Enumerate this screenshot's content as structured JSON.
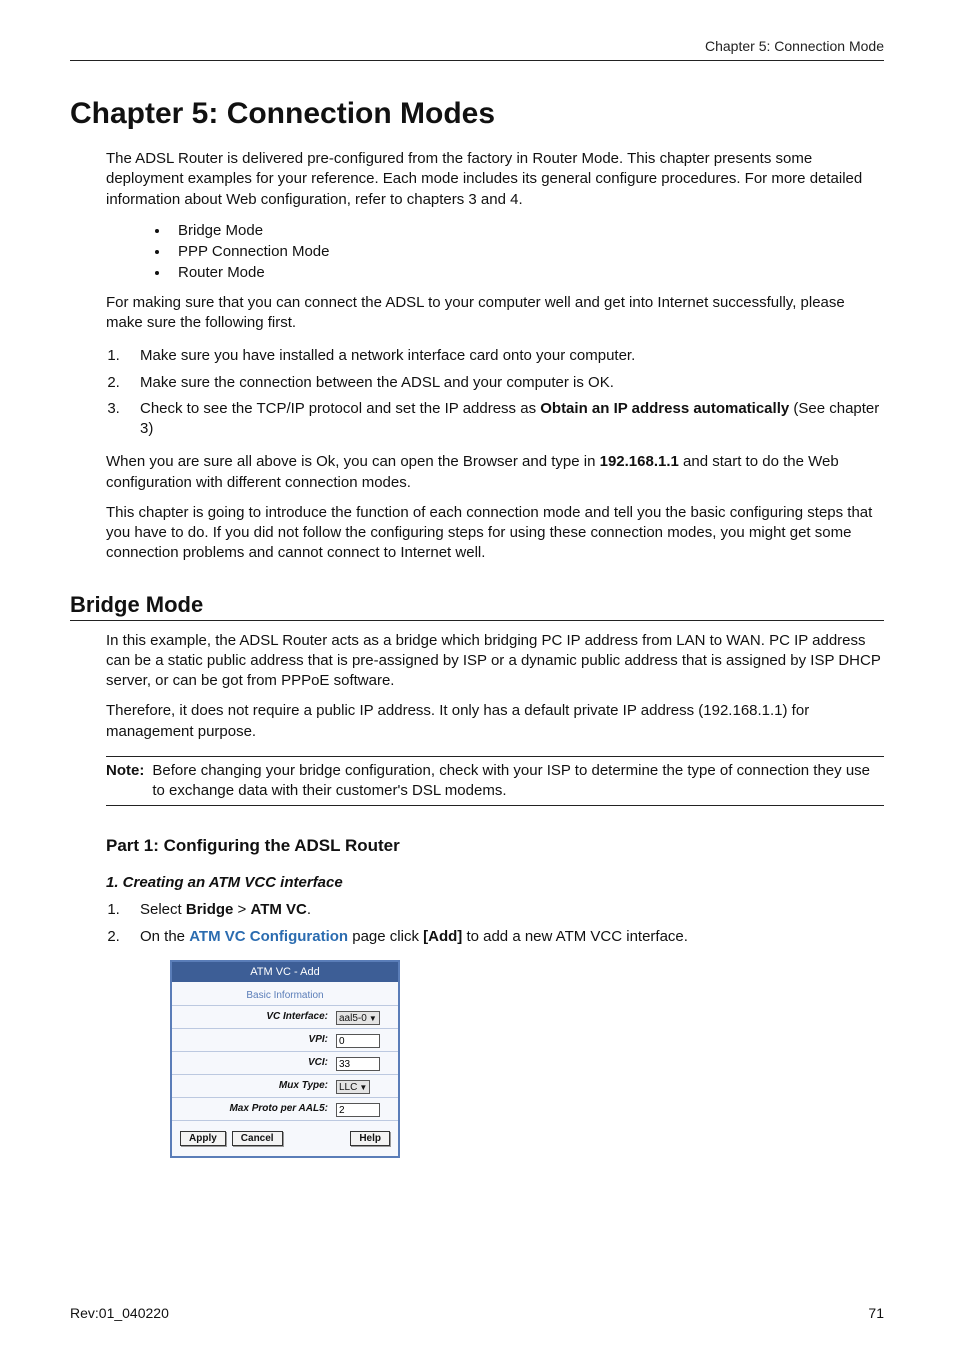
{
  "header": {
    "running": "Chapter 5: Connection Mode"
  },
  "chapter": {
    "title": "Chapter 5: Connection Modes",
    "intro": "The ADSL Router is delivered pre-configured from the factory in Router Mode. This chapter presents some deployment examples for your reference. Each mode includes its general configure procedures. For more detailed information about Web configuration, refer to chapters 3 and 4.",
    "modes": [
      "Bridge Mode",
      "PPP Connection Mode",
      "Router Mode"
    ],
    "connect_intro": "For making sure that you can connect the ADSL to your computer well and get into Internet successfully, please make sure the following first.",
    "steps": {
      "s1": "Make sure you have installed a network interface card onto your computer.",
      "s2": "Make sure the connection between the ADSL and your computer is OK.",
      "s3_pre": "Check to see the TCP/IP protocol and set the IP address as ",
      "s3_bold": "Obtain an IP address automatically",
      "s3_post": " (See chapter 3)"
    },
    "browser_p_pre": "When you are sure all above is Ok, you can open the Browser and type in ",
    "browser_ip": "192.168.1.1",
    "browser_p_post": " and start to do the Web configuration with different connection modes.",
    "closing": "This chapter is going to introduce the function of each connection mode and tell you the basic configuring steps that you have to do. If you did not follow the configuring steps for using these connection modes, you might get some connection problems and cannot connect to Internet well."
  },
  "bridge": {
    "title": "Bridge Mode",
    "p1": "In this example, the ADSL Router acts as a bridge which bridging PC IP address from LAN to WAN. PC IP address can be a static public address that is pre-assigned by ISP or a dynamic public address that is assigned by ISP DHCP server, or can be got from PPPoE software.",
    "p2": "Therefore, it does not require a public IP address. It only has a default private IP address (192.168.1.1) for management purpose.",
    "note_label": "Note",
    "note_text": "Before changing your bridge configuration, check with your ISP to determine the type of connection they use to exchange data with their customer's DSL modems."
  },
  "part1": {
    "title": "Part 1: Configuring the ADSL Router",
    "sub": "1. Creating an ATM VCC interface",
    "step1_pre": "Select ",
    "step1_b1": "Bridge",
    "step1_sep": " > ",
    "step1_b2": "ATM VC",
    "step1_post": ".",
    "step2_pre": "On the ",
    "step2_link": "ATM VC Configuration",
    "step2_mid": " page click ",
    "step2_add": "[Add]",
    "step2_post": " to add a new ATM VCC interface."
  },
  "atm": {
    "title": "ATM VC - Add",
    "section": "Basic Information",
    "rows": {
      "vc_interface": {
        "label": "VC Interface:",
        "value": "aal5-0"
      },
      "vpi": {
        "label": "VPI:",
        "value": "0"
      },
      "vci": {
        "label": "VCI:",
        "value": "33"
      },
      "mux": {
        "label": "Mux Type:",
        "value": "LLC"
      },
      "max_proto": {
        "label": "Max Proto per AAL5:",
        "value": "2"
      }
    },
    "buttons": {
      "apply": "Apply",
      "cancel": "Cancel",
      "help": "Help"
    }
  },
  "footer": {
    "rev": "Rev:01_040220",
    "page": "71"
  }
}
